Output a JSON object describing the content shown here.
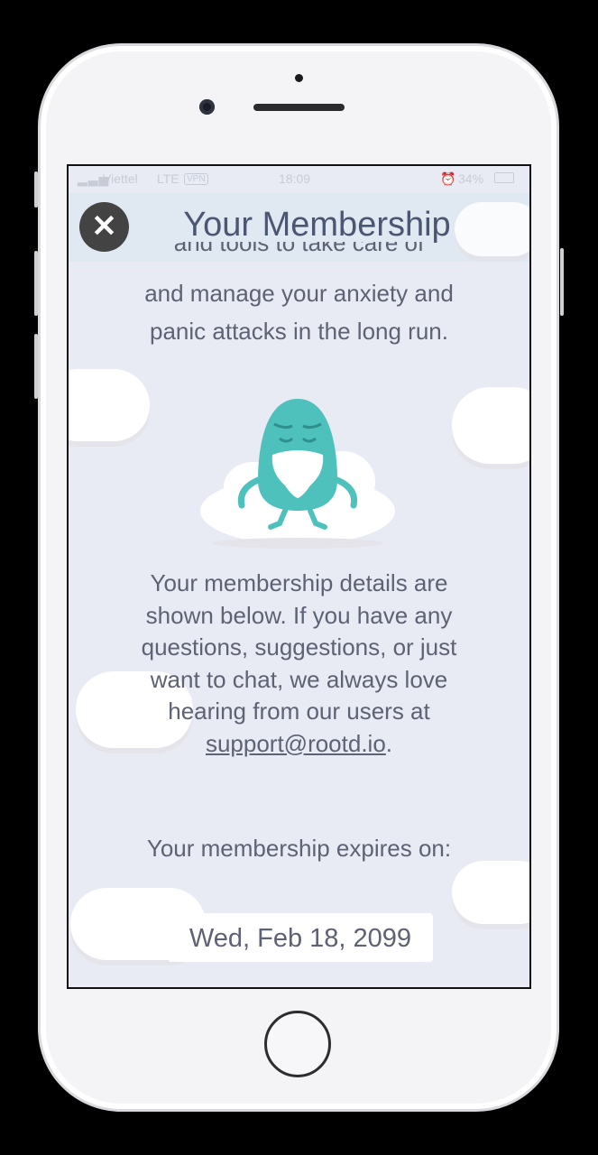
{
  "status_bar": {
    "carrier": "Viettel",
    "network": "LTE",
    "vpn": "VPN",
    "time": "18:09",
    "battery": "34%"
  },
  "header": {
    "title": "Your Membership",
    "close_icon": "close-icon"
  },
  "intro": {
    "line_cut": "and tools to take care of",
    "text": "and manage your anxiety and panic attacks in the long run."
  },
  "details": {
    "text_before": "Your membership details are shown below. If you have any questions, suggestions, or just want to chat, we always love hearing from our users at ",
    "email": "support@rootd.io",
    "text_after": "."
  },
  "expiry": {
    "label": "Your membership expires on:",
    "date": "Wed, Feb 18, 2099"
  },
  "colors": {
    "background": "#e9ebf4",
    "text": "#5d6274",
    "title": "#4b5673",
    "mascot": "#4fc1bd"
  }
}
